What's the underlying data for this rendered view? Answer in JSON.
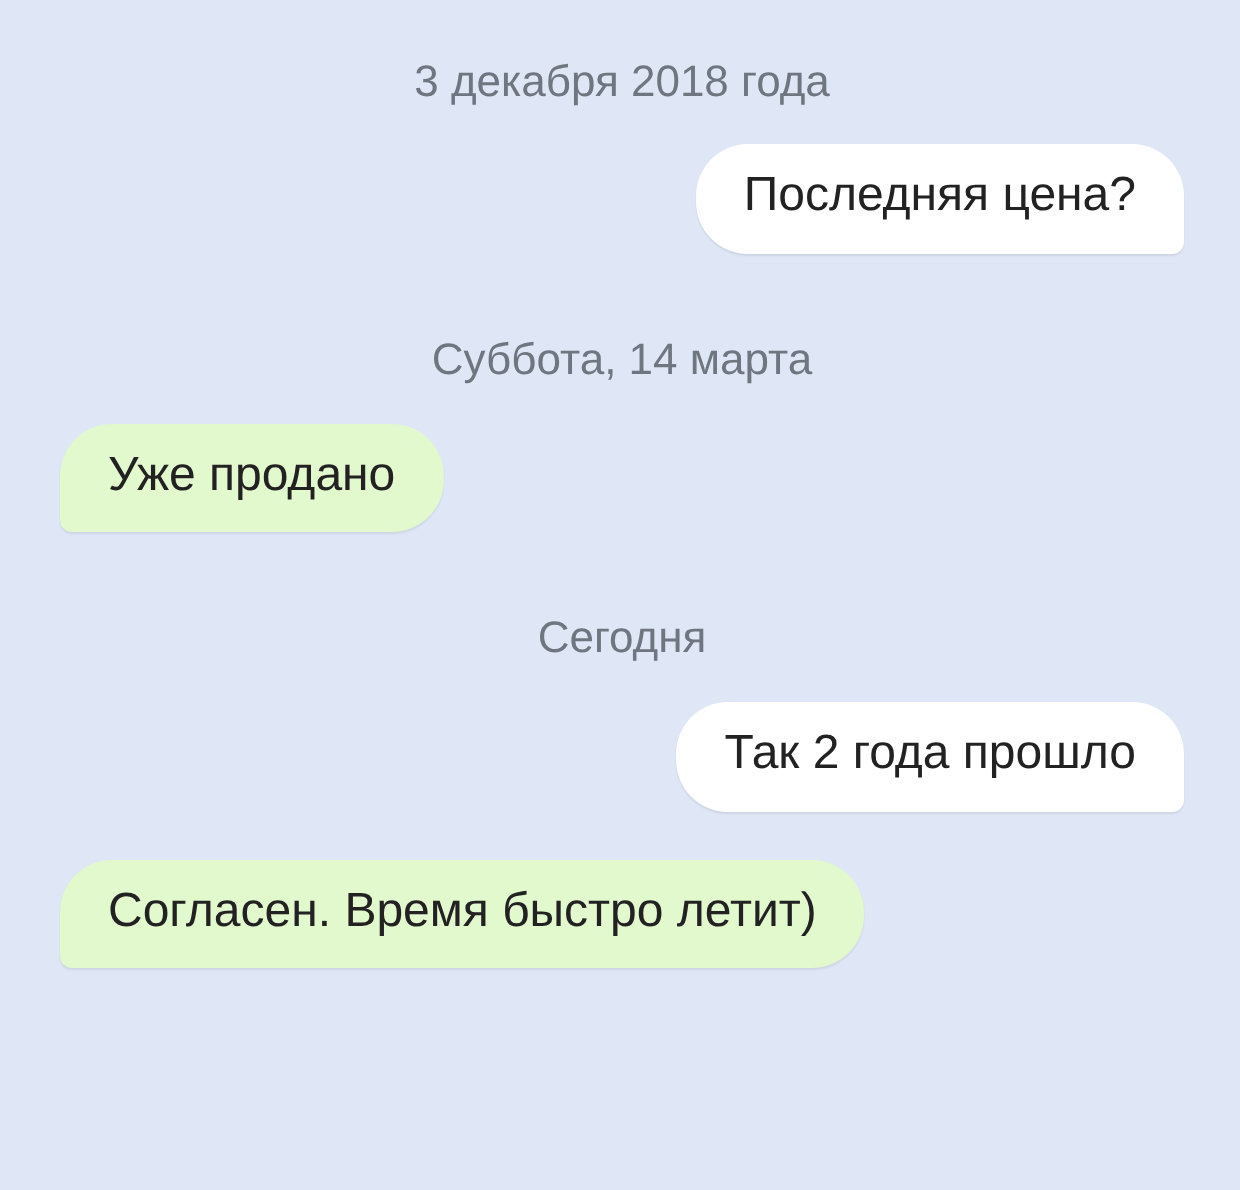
{
  "chat": [
    {
      "kind": "date",
      "text": "3 декабря 2018 года"
    },
    {
      "kind": "message",
      "outgoing": true,
      "text": "Последняя цена?"
    },
    {
      "kind": "date",
      "text": "Суббота, 14 марта"
    },
    {
      "kind": "message",
      "outgoing": false,
      "text": "Уже продано"
    },
    {
      "kind": "date",
      "text": "Сегодня"
    },
    {
      "kind": "message",
      "outgoing": true,
      "text": "Так 2 года прошло"
    },
    {
      "kind": "message",
      "outgoing": false,
      "text": "Согласен. Время быстро летит)"
    }
  ]
}
